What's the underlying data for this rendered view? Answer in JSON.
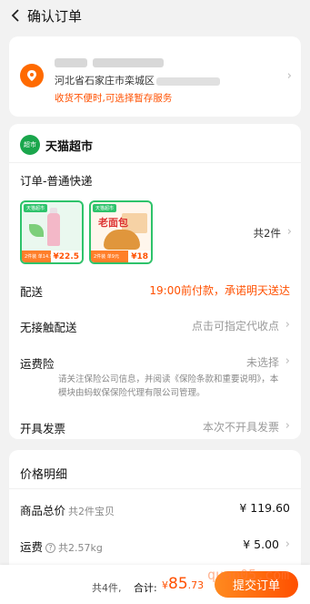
{
  "header": {
    "title": "确认订单"
  },
  "address": {
    "line": "河北省石家庄市栾城区",
    "hint": "收货不便时,可选择暂存服务"
  },
  "shop": {
    "badge": "超市",
    "name": "天猫超市"
  },
  "order": {
    "shipping_type": "订单-普通快递",
    "products": [
      {
        "tag": "天猫超市",
        "foot": "2件装 单14.9元",
        "price": "¥22.5",
        "brand": ""
      },
      {
        "tag": "天猫超市",
        "foot": "2件装 单9元",
        "price": "¥18",
        "brand": "老面包"
      }
    ],
    "count": "共2件",
    "delivery": {
      "label": "配送",
      "value": "19:00前付款，承诺明天送达"
    },
    "contactless": {
      "label": "无接触配送",
      "value": "点击可指定代收点"
    },
    "insurance": {
      "label": "运费险",
      "value": "未选择",
      "note": "请关注保险公司信息，并阅读《保险条款和重要说明》，本模块由蚂蚁保保险代理有限公司管理。"
    },
    "invoice": {
      "label": "开具发票",
      "value": "本次不开具发票"
    }
  },
  "price_detail": {
    "title": "价格明细",
    "goods_total": {
      "label": "商品总价",
      "sub": "共2件宝贝",
      "value": "¥ 119.60"
    },
    "freight": {
      "label": "运费",
      "sub": "共2.57kg",
      "value": "¥ 5.00"
    }
  },
  "bottom": {
    "count": "共4件,",
    "total_label": "合计:",
    "currency": "¥",
    "total_int": "85",
    "total_dec": ".73",
    "submit": "提交订单",
    "watermark": "quan05.com"
  },
  "colors": {
    "accent": "#ff5000",
    "shop_green": "#1aa64c"
  }
}
